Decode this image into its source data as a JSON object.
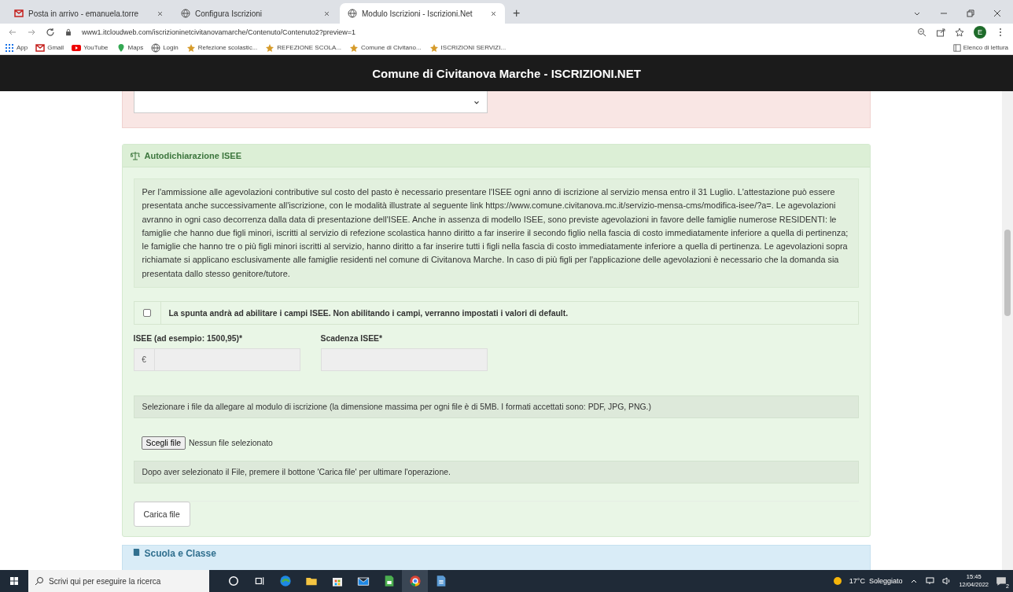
{
  "browser": {
    "tabs": [
      {
        "title": "Posta in arrivo - emanuela.torre",
        "kind": "mail",
        "selected": false
      },
      {
        "title": "Configura Iscrizioni",
        "kind": "globe",
        "selected": false
      },
      {
        "title": "Modulo Iscrizioni - Iscrizioni.Net",
        "kind": "globe",
        "selected": true
      }
    ],
    "new_tab": "+",
    "url": "www1.itcloudweb.com/iscrizioninetcivitanovamarche/Contenuto/Contenuto2?preview=1",
    "avatar": "E",
    "bookmarks": [
      {
        "label": "App",
        "kind": "apps"
      },
      {
        "label": "Gmail",
        "kind": "mail"
      },
      {
        "label": "YouTube",
        "kind": "video"
      },
      {
        "label": "Maps",
        "kind": "map"
      },
      {
        "label": "Login",
        "kind": "globe"
      },
      {
        "label": "Refezione scolastic...",
        "kind": "site"
      },
      {
        "label": "REFEZIONE SCOLA...",
        "kind": "site"
      },
      {
        "label": "Comune di Civitano...",
        "kind": "site"
      },
      {
        "label": "ISCRIZIONI SERVIZI...",
        "kind": "site"
      }
    ],
    "reading_list": "Elenco di lettura"
  },
  "page": {
    "header": "Comune di Civitanova Marche - ISCRIZIONI.NET",
    "isee_section": {
      "title": "Autodichiarazione ISEE",
      "info": "Per l'ammissione alle agevolazioni contributive sul costo del pasto è necessario presentare l'ISEE ogni anno di iscrizione al servizio mensa entro il 31 Luglio. L'attestazione può essere presentata anche successivamente all'iscrizione, con le modalità illustrate al seguente link https://www.comune.civitanova.mc.it/servizio-mensa-cms/modifica-isee/?a=. Le agevolazioni avranno in ogni caso decorrenza dalla data di presentazione dell'ISEE. Anche in assenza di modello ISEE, sono previste agevolazioni in favore delle famiglie numerose RESIDENTI: le famiglie che hanno due figli minori, iscritti al servizio di refezione scolastica hanno diritto a far inserire il secondo figlio nella fascia di costo immediatamente inferiore a quella di pertinenza; le famiglie che hanno tre o più figli minori iscritti al servizio, hanno diritto a far inserire tutti i figli nella fascia di costo immediatamente inferiore a quella di pertinenza. Le agevolazioni sopra richiamate si applicano esclusivamente alle famiglie residenti nel comune di Civitanova Marche. In caso di più figli per l'applicazione delle agevolazioni è necessario che la domanda sia presentata dallo stesso genitore/tutore.",
      "enable_checkbox": {
        "label": "La spunta andrà ad abilitare i campi ISEE. Non abilitando i campi, verranno impostati i valori di default.",
        "checked": false
      },
      "isee_field": {
        "label": "ISEE (ad esempio: 1500,95)*",
        "prefix": "€",
        "disabled": true
      },
      "expiry_field": {
        "label": "Scadenza ISEE*",
        "disabled": true
      },
      "files_note": "Selezionare i file da allegare al modulo di iscrizione (la dimensione massima per ogni file è di 5MB. I formati accettati sono: PDF, JPG, PNG.)",
      "choose_file": "Scegli file",
      "no_file": "Nessun file selezionato",
      "upload_note": "Dopo aver selezionato il File, premere il bottone 'Carica file' per ultimare l'operazione.",
      "upload_button": "Carica file"
    },
    "next_section": {
      "title": "Scuola e Classe"
    }
  },
  "taskbar": {
    "search_placeholder": "Scrivi qui per eseguire la ricerca",
    "apps": [
      {
        "kind": "cortana",
        "selected": false
      },
      {
        "kind": "taskview",
        "selected": false
      },
      {
        "kind": "edge",
        "selected": false
      },
      {
        "kind": "folder",
        "selected": false
      },
      {
        "kind": "store",
        "selected": false
      },
      {
        "kind": "mail",
        "selected": false
      },
      {
        "kind": "sheet",
        "selected": false
      },
      {
        "kind": "chrome",
        "selected": true
      },
      {
        "kind": "doc",
        "selected": false
      }
    ],
    "weather": "17°C  Soleggiato",
    "time": "15:45",
    "date": "12/04/2022",
    "notifications": "2"
  }
}
